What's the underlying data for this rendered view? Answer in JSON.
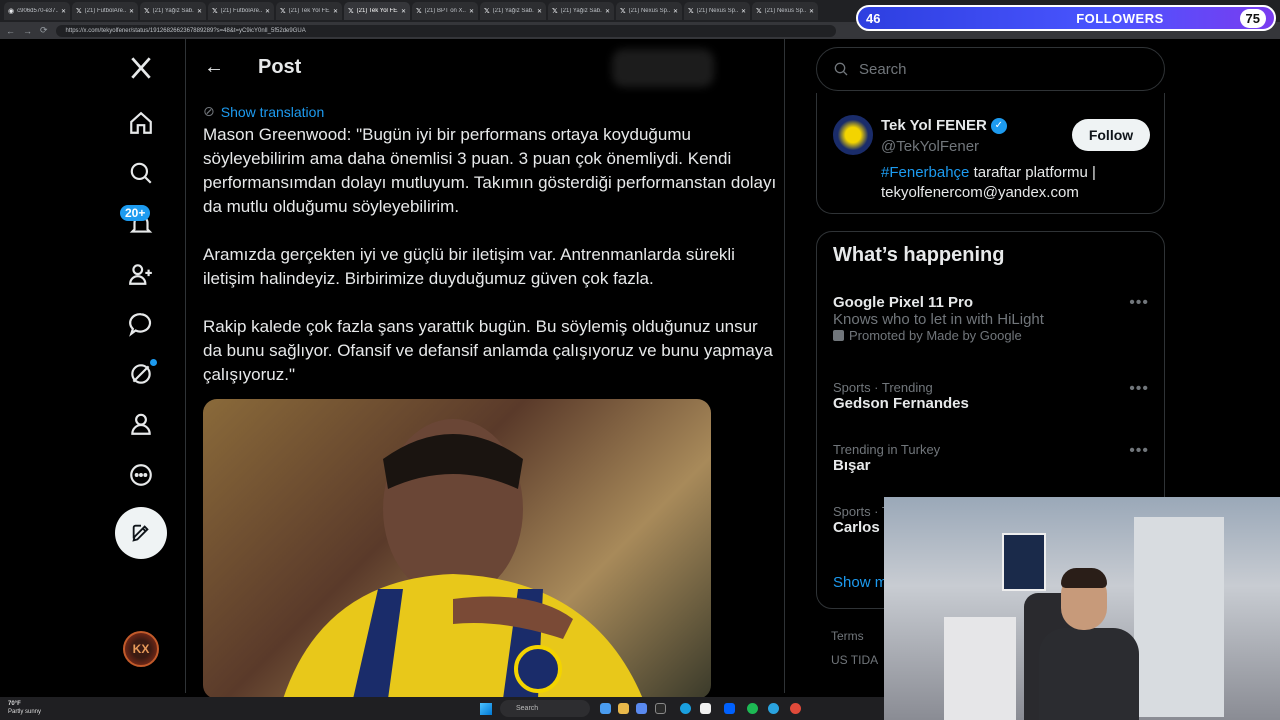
{
  "browser": {
    "tabs": [
      {
        "title": "c906d570-e37...",
        "active": false
      },
      {
        "title": "(21) FutbolAre...",
        "active": false
      },
      {
        "title": "(21) Yağız Sab...",
        "active": false
      },
      {
        "title": "(21) FutbolAre...",
        "active": false
      },
      {
        "title": "(21) Tek Yol FE...",
        "active": false
      },
      {
        "title": "(21) Tek Yol FE...",
        "active": true
      },
      {
        "title": "(21) BPT on X...",
        "active": false
      },
      {
        "title": "(21) Yağız Sab...",
        "active": false
      },
      {
        "title": "(21) Yağız Sab...",
        "active": false
      },
      {
        "title": "(21) Nexus Sp...",
        "active": false
      },
      {
        "title": "(21) Nexus Sp...",
        "active": false
      },
      {
        "title": "(21) Nexus Sp...",
        "active": false
      }
    ],
    "url": "https://x.com/tekyolfener/status/1912682662367889289?s=48&t=yC9icY0nlI_5f52de9GUA"
  },
  "followers_goal": {
    "current": "46",
    "label": "FOLLOWERS",
    "goal": "75"
  },
  "nav": {
    "notifications_badge": "20+"
  },
  "post": {
    "header_title": "Post",
    "show_translation": "Show translation",
    "paragraphs": [
      "Mason Greenwood: \"Bugün iyi bir performans ortaya koyduğumu söyleyebilirim ama daha önemlisi 3 puan. 3 puan çok önemliydi. Kendi performansımdan dolayı mutluyum. Takımın gösterdiği performanstan dolayı da mutlu olduğumu söyleyebilirim.",
      "Aramızda gerçekten iyi ve güçlü bir iletişim var. Antrenmanlarda sürekli iletişim halindeyiz. Birbirimize duyduğumuz güven çok fazla.",
      "Rakip kalede çok fazla şans yarattık bugün. Bu söylemiş olduğunuz unsur da bunu sağlıyor. Ofansif ve defansif anlamda çalışıyoruz ve bunu yapmaya çalışıyoruz.\""
    ]
  },
  "sidebar": {
    "search_placeholder": "Search",
    "account": {
      "name": "Tek Yol FENER",
      "handle": "@TekYolFener",
      "bio_tag": "#Fenerbahçe",
      "bio_rest": " taraftar platformu | tekyolfenercom@yandex.com",
      "follow_label": "Follow"
    },
    "whats_happening": {
      "title": "What’s happening",
      "trends": [
        {
          "meta": "",
          "title": "Google Pixel 11 Pro",
          "desc": "Knows who to let in with HiLight",
          "promo": "Promoted by Made by Google"
        },
        {
          "meta": "Sports · Trending",
          "title": "Gedson Fernandes",
          "desc": "",
          "promo": ""
        },
        {
          "meta": "Trending in Turkey",
          "title": "Bışar",
          "desc": "",
          "promo": ""
        },
        {
          "meta": "Sports · T",
          "title": "Carlos I",
          "desc": "",
          "promo": ""
        }
      ],
      "show_more": "Show m"
    },
    "footer": {
      "terms": "Terms",
      "ads": "US TIDA"
    }
  },
  "taskbar": {
    "weather_temp": "70°F",
    "weather_desc": "Partly sunny",
    "search_label": "Search"
  },
  "colors": {
    "accent": "#1d9bf0",
    "background": "#000000",
    "border": "#2f3336",
    "muted": "#71767b"
  }
}
